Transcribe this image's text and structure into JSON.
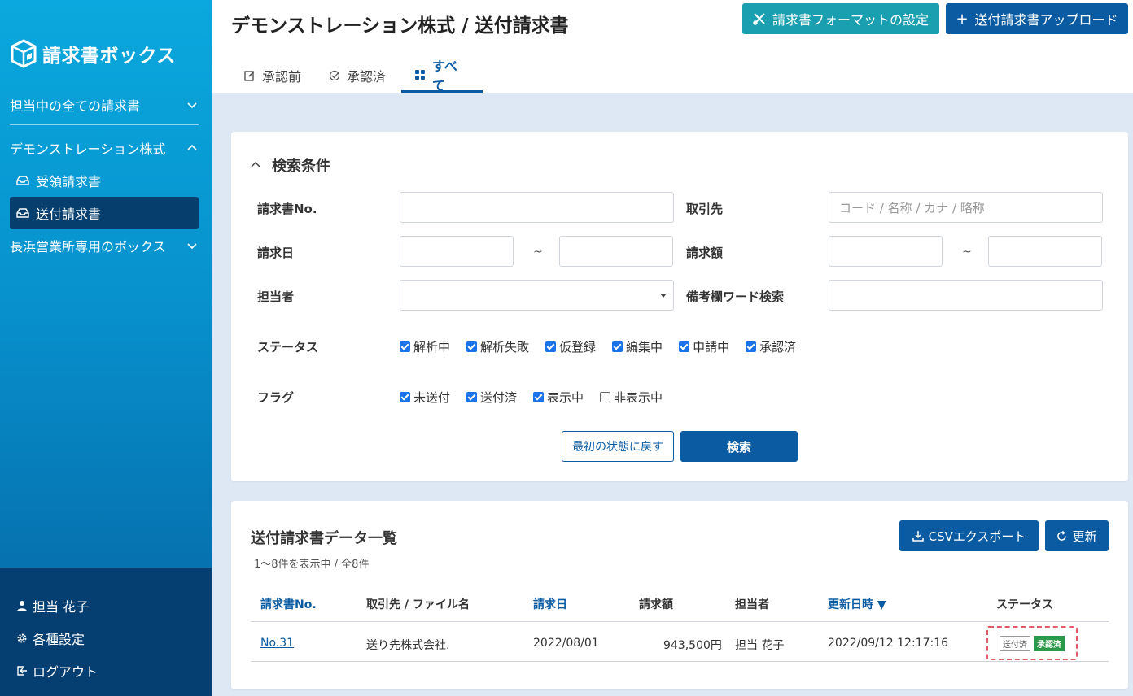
{
  "sidebar": {
    "logo_text": "請求書ボックス",
    "group_all": "担当中の全ての請求書",
    "group_demo": "デモンストレーション株式",
    "item_received": "受領請求書",
    "item_sent": "送付請求書",
    "group_nagahama": "長浜営業所専用のボックス",
    "user": "担当 花子",
    "settings": "各種設定",
    "logout": "ログアウト"
  },
  "header": {
    "title": "デモンストレーション株式 / 送付請求書",
    "format_button": "請求書フォーマットの設定",
    "upload_button": "送付請求書アップロード",
    "tabs": [
      {
        "label": "承認前"
      },
      {
        "label": "承認済"
      },
      {
        "label": "すべて"
      }
    ]
  },
  "search": {
    "title": "検索条件",
    "invoice_no_label": "請求書No.",
    "partner_label": "取引先",
    "partner_placeholder": "コード / 名称 / カナ / 略称",
    "date_label": "請求日",
    "amount_label": "請求額",
    "tilde": "~",
    "assignee_label": "担当者",
    "memo_label": "備考欄ワード検索",
    "status_label": "ステータス",
    "status_options": [
      "解析中",
      "解析失敗",
      "仮登録",
      "編集中",
      "申請中",
      "承認済"
    ],
    "flag_label": "フラグ",
    "flag_options": [
      "未送付",
      "送付済",
      "表示中",
      "非表示中"
    ],
    "reset_button": "最初の状態に戻す",
    "search_button": "検索"
  },
  "list": {
    "title": "送付請求書データ一覧",
    "count": "1〜8件を表示中 / 全8件",
    "csv_button": "CSVエクスポート",
    "refresh_button": "更新",
    "columns": [
      "請求書No.",
      "取引先 / ファイル名",
      "請求日",
      "請求額",
      "担当者",
      "更新日時 ▼",
      "ステータス"
    ],
    "rows": [
      {
        "no": "No.31",
        "partner": "送り先株式会社.",
        "date": "2022/08/01",
        "amount": "943,500円",
        "assignee": "担当 花子",
        "updated": "2022/09/12 12:17:16",
        "badge_sent": "送付済",
        "badge_status": "承認済"
      }
    ]
  }
}
